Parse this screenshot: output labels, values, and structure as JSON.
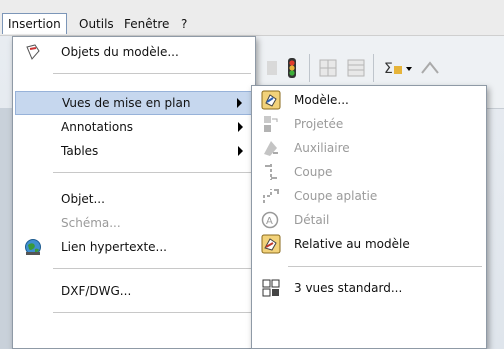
{
  "menubar": {
    "items": [
      "Insertion",
      "Outils",
      "Fenêtre",
      "?"
    ]
  },
  "insertion_menu": {
    "items": [
      {
        "label": "Objets du modèle...",
        "icon": "model-objects-icon",
        "disabled": false
      },
      {
        "label": "Vues de mise en plan",
        "icon": "",
        "submenu": true,
        "highlighted": true
      },
      {
        "label": "Annotations",
        "icon": "",
        "submenu": true
      },
      {
        "label": "Tables",
        "icon": "",
        "submenu": true
      },
      {
        "label": "Objet...",
        "icon": ""
      },
      {
        "label": "Schéma...",
        "icon": "",
        "disabled": true
      },
      {
        "label": "Lien hypertexte...",
        "icon": "globe-icon"
      },
      {
        "label": "DXF/DWG...",
        "icon": ""
      }
    ]
  },
  "submenu_vues": {
    "items": [
      {
        "label": "Modèle...",
        "icon": "model-view-icon",
        "disabled": false
      },
      {
        "label": "Projetée",
        "icon": "projected-view-icon",
        "disabled": true
      },
      {
        "label": "Auxiliaire",
        "icon": "auxiliary-view-icon",
        "disabled": true
      },
      {
        "label": "Coupe",
        "icon": "section-view-icon",
        "disabled": true
      },
      {
        "label": "Coupe aplatie",
        "icon": "aligned-section-icon",
        "disabled": true
      },
      {
        "label": "Détail",
        "icon": "detail-view-icon",
        "disabled": true
      },
      {
        "label": "Relative au modèle",
        "icon": "relative-view-icon",
        "disabled": false
      },
      {
        "label": "3 vues standard...",
        "icon": "standard-3-views-icon",
        "disabled": false
      }
    ]
  },
  "colors": {
    "highlight": "#c6d7ee",
    "disabled_text": "#9a9a9a"
  }
}
